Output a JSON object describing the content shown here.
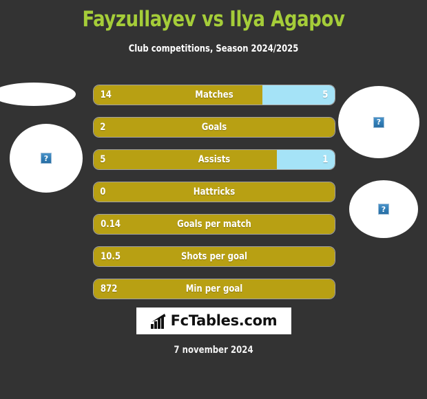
{
  "header": {
    "title": "Fayzullayev vs Ilya Agapov",
    "subtitle": "Club competitions, Season 2024/2025"
  },
  "colors": {
    "background": "#333333",
    "title_green": "#a5cd39",
    "home_gold": "#b8a013",
    "away_blue": "#a5e3f7",
    "text_white": "#ffffff"
  },
  "avatars": {
    "home_small": {
      "icon": "broken-image-icon",
      "glyph": "?"
    },
    "home_big": {
      "icon": "broken-image-icon",
      "glyph": "?"
    },
    "away_big": {
      "icon": "broken-image-icon",
      "glyph": "?"
    },
    "away_small": {
      "icon": "broken-image-icon",
      "glyph": "?"
    }
  },
  "logo": {
    "text": "FcTables.com",
    "icon": "bar-chart-arrow-icon"
  },
  "footer": {
    "date": "7 november 2024"
  },
  "chart_data": {
    "type": "bar",
    "title": "Fayzullayev vs Ilya Agapov",
    "subtitle": "Club competitions, Season 2024/2025",
    "orientation": "horizontal",
    "grid": false,
    "legend": null,
    "series": [
      {
        "name": "Fayzullayev",
        "color": "#b8a013"
      },
      {
        "name": "Ilya Agapov",
        "color": "#a5e3f7"
      }
    ],
    "categories": [
      "Matches",
      "Goals",
      "Assists",
      "Hattricks",
      "Goals per match",
      "Shots per goal",
      "Min per goal"
    ],
    "rows": [
      {
        "label": "Matches",
        "home": "14",
        "away": "5",
        "home_pct": 70,
        "away_pct": 30,
        "has_away": true
      },
      {
        "label": "Goals",
        "home": "2",
        "away": "",
        "home_pct": 100,
        "away_pct": 0,
        "has_away": false
      },
      {
        "label": "Assists",
        "home": "5",
        "away": "1",
        "home_pct": 76,
        "away_pct": 24,
        "has_away": true
      },
      {
        "label": "Hattricks",
        "home": "0",
        "away": "",
        "home_pct": 100,
        "away_pct": 0,
        "has_away": false
      },
      {
        "label": "Goals per match",
        "home": "0.14",
        "away": "",
        "home_pct": 100,
        "away_pct": 0,
        "has_away": false
      },
      {
        "label": "Shots per goal",
        "home": "10.5",
        "away": "",
        "home_pct": 100,
        "away_pct": 0,
        "has_away": false
      },
      {
        "label": "Min per goal",
        "home": "872",
        "away": "",
        "home_pct": 100,
        "away_pct": 0,
        "has_away": false
      }
    ]
  }
}
